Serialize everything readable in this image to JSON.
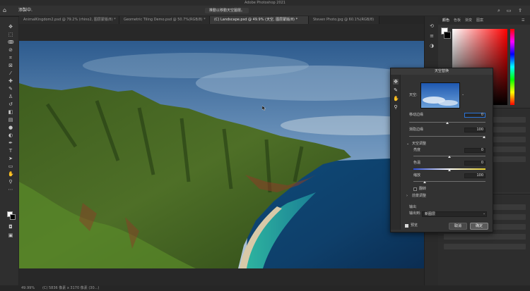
{
  "app": {
    "title": "Adobe Photoshop 2021"
  },
  "options_bar": {
    "status": "添製中.",
    "message": "推動以移動天空圖層。"
  },
  "tabs": [
    {
      "label": "AnimalKingdom2.psd @ 79.2% (rhino2, 图层蒙版/8) *"
    },
    {
      "label": "Geometric Tiling Demo.psd @ 50.7%(RGB/8) *"
    },
    {
      "label": "(C) Landscape.psd @ 49.9% (天空, 图层蒙版/8) *"
    },
    {
      "label": "Steven Photo.jpg @ 60.1%(RGB/8)"
    }
  ],
  "right_panel": {
    "tabs": [
      "颜色",
      "色板",
      "渐变",
      "图案"
    ]
  },
  "status_bar": {
    "zoom": "49.99%",
    "info": "(C) 5836 像素 x 3170 像素 (30...)"
  },
  "dialog": {
    "title": "天空替换",
    "sky_label": "天空:",
    "shift_edge": {
      "label": "移动边缘",
      "value": "0"
    },
    "fade_edge": {
      "label": "渐隐边缘",
      "value": "100"
    },
    "sky_adjust": {
      "label": "天空调整",
      "brightness": {
        "label": "亮度",
        "value": "0"
      },
      "temperature": {
        "label": "色温",
        "value": "0"
      },
      "scale": {
        "label": "缩放",
        "value": "100"
      },
      "flip": "翻转"
    },
    "foreground_adjust": {
      "label": "前景调整"
    },
    "output": {
      "label": "输出",
      "output_to_label": "输出到:",
      "output_to_value": "新图层"
    },
    "preview": "预览",
    "cancel": "取消",
    "ok": "确定"
  },
  "colors": {
    "accent": "#2a73d8",
    "panel": "#323232",
    "toolbar": "#2f2f2f"
  }
}
